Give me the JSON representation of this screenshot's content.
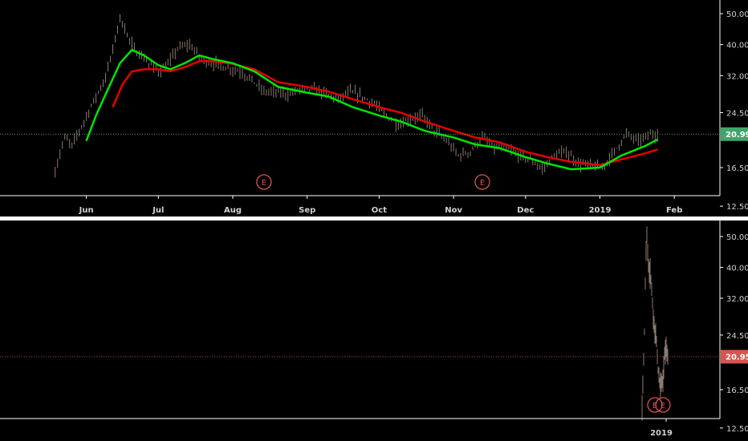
{
  "colors": {
    "background": "#000000",
    "candle": "#8a7a70",
    "fast_ma": "#00e600",
    "slow_ma": "#e60000",
    "price_line": "#c04040",
    "badge_top": "#3fa66a",
    "badge_bottom": "#d9534f",
    "earnings": "#d9534f",
    "divider": "#ffffff",
    "axis": "#ffffff"
  },
  "chart_data": [
    {
      "type": "line",
      "scale": "log",
      "yticks": [
        "50.00",
        "40.00",
        "32.00",
        "24.50",
        "16.50",
        "12.50"
      ],
      "ytick_values": [
        50,
        40,
        32,
        24.5,
        16.5,
        12.5
      ],
      "ylim": [
        12.5,
        55
      ],
      "xlabels": [
        "Jun",
        "Jul",
        "Aug",
        "Sep",
        "Oct",
        "Nov",
        "Dec",
        "2019",
        "Feb"
      ],
      "xlabel_dates": [
        "2018-06-01",
        "2018-07-01",
        "2018-08-01",
        "2018-09-01",
        "2018-10-01",
        "2018-11-01",
        "2018-12-01",
        "2019-01-01",
        "2019-02-01"
      ],
      "xlim": [
        "2018-04-26",
        "2019-02-20"
      ],
      "last_price": 20.99,
      "last_price_label": "20.99",
      "earnings_markers": [
        {
          "date": "2018-08-14",
          "label": "E"
        },
        {
          "date": "2018-11-13",
          "label": "E"
        }
      ],
      "series": [
        {
          "role": "price",
          "x": [
            "2018-05-19",
            "2018-05-23",
            "2018-05-26",
            "2018-05-31",
            "2018-06-05",
            "2018-06-09",
            "2018-06-12",
            "2018-06-15",
            "2018-06-18",
            "2018-06-21",
            "2018-06-24",
            "2018-06-27",
            "2018-07-01",
            "2018-07-05",
            "2018-07-09",
            "2018-07-14",
            "2018-07-19",
            "2018-07-24",
            "2018-07-29",
            "2018-08-04",
            "2018-08-09",
            "2018-08-14",
            "2018-08-19",
            "2018-08-24",
            "2018-08-29",
            "2018-09-04",
            "2018-09-09",
            "2018-09-14",
            "2018-09-19",
            "2018-09-24",
            "2018-09-29",
            "2018-10-04",
            "2018-10-09",
            "2018-10-14",
            "2018-10-19",
            "2018-10-24",
            "2018-10-29",
            "2018-11-03",
            "2018-11-08",
            "2018-11-13",
            "2018-11-18",
            "2018-11-23",
            "2018-11-28",
            "2018-12-03",
            "2018-12-08",
            "2018-12-13",
            "2018-12-18",
            "2018-12-23",
            "2018-12-28",
            "2019-01-02",
            "2019-01-07",
            "2019-01-12",
            "2019-01-17",
            "2019-01-22",
            "2019-01-25"
          ],
          "values": [
            16.0,
            20.5,
            19.3,
            23.0,
            27.5,
            31.5,
            38.5,
            48.5,
            43.0,
            38.5,
            37.0,
            35.0,
            33.0,
            34.5,
            39.0,
            40.0,
            36.0,
            35.0,
            34.0,
            33.0,
            31.0,
            28.5,
            28.5,
            28.0,
            29.0,
            29.0,
            28.0,
            27.0,
            28.5,
            27.5,
            26.0,
            24.0,
            22.5,
            23.5,
            24.0,
            21.5,
            20.0,
            18.0,
            18.5,
            20.5,
            19.0,
            19.0,
            18.0,
            17.5,
            16.3,
            18.0,
            18.5,
            17.0,
            16.8,
            16.5,
            18.5,
            21.0,
            20.0,
            21.0,
            21.0
          ]
        },
        {
          "role": "fast_ma",
          "x": [
            "2018-06-01",
            "2018-06-05",
            "2018-06-10",
            "2018-06-15",
            "2018-06-20",
            "2018-06-25",
            "2018-07-01",
            "2018-07-06",
            "2018-07-12",
            "2018-07-18",
            "2018-07-24",
            "2018-08-01",
            "2018-08-10",
            "2018-08-20",
            "2018-09-01",
            "2018-09-10",
            "2018-09-20",
            "2018-10-01",
            "2018-10-10",
            "2018-10-20",
            "2018-11-01",
            "2018-11-10",
            "2018-11-20",
            "2018-12-01",
            "2018-12-10",
            "2018-12-20",
            "2019-01-01",
            "2019-01-10",
            "2019-01-20",
            "2019-01-25"
          ],
          "values": [
            20.0,
            24.0,
            29.0,
            35.0,
            38.5,
            37.0,
            34.5,
            33.5,
            35.0,
            37.0,
            36.0,
            35.0,
            33.0,
            29.5,
            28.3,
            27.5,
            25.5,
            24.0,
            23.0,
            21.5,
            20.5,
            19.5,
            19.0,
            17.8,
            17.0,
            16.3,
            16.5,
            18.0,
            19.3,
            20.2
          ]
        },
        {
          "role": "slow_ma",
          "x": [
            "2018-06-12",
            "2018-06-16",
            "2018-06-20",
            "2018-06-25",
            "2018-07-01",
            "2018-07-06",
            "2018-07-12",
            "2018-07-18",
            "2018-07-24",
            "2018-08-01",
            "2018-08-10",
            "2018-08-20",
            "2018-09-01",
            "2018-09-10",
            "2018-09-20",
            "2018-10-01",
            "2018-10-10",
            "2018-10-20",
            "2018-11-01",
            "2018-11-10",
            "2018-11-20",
            "2018-12-01",
            "2018-12-10",
            "2018-12-20",
            "2019-01-01",
            "2019-01-10",
            "2019-01-20",
            "2019-01-25"
          ],
          "values": [
            25.5,
            30.0,
            33.0,
            33.5,
            33.5,
            33.0,
            34.0,
            35.5,
            35.5,
            34.8,
            33.5,
            30.5,
            29.5,
            28.5,
            27.0,
            25.5,
            24.5,
            23.0,
            21.5,
            20.5,
            19.8,
            18.5,
            17.8,
            17.2,
            16.8,
            17.5,
            18.3,
            18.8
          ]
        }
      ]
    },
    {
      "type": "line",
      "scale": "log",
      "yticks": [
        "50.00",
        "40.00",
        "32.00",
        "24.50",
        "16.50",
        "12.50"
      ],
      "ytick_values": [
        50,
        40,
        32,
        24.5,
        16.5,
        12.5
      ],
      "ylim": [
        12.5,
        55
      ],
      "xlabels": [
        "2019"
      ],
      "last_price": 20.95,
      "last_price_label": "20.95",
      "earnings_markers": [
        {
          "label": "E"
        },
        {
          "label": "E"
        }
      ],
      "series": [
        {
          "role": "price",
          "values": [
            14.5,
            22.0,
            50.0,
            42.0,
            38.0,
            30.0,
            26.0,
            22.0,
            17.0,
            16.5,
            19.0,
            22.0,
            21.0
          ]
        }
      ]
    }
  ]
}
